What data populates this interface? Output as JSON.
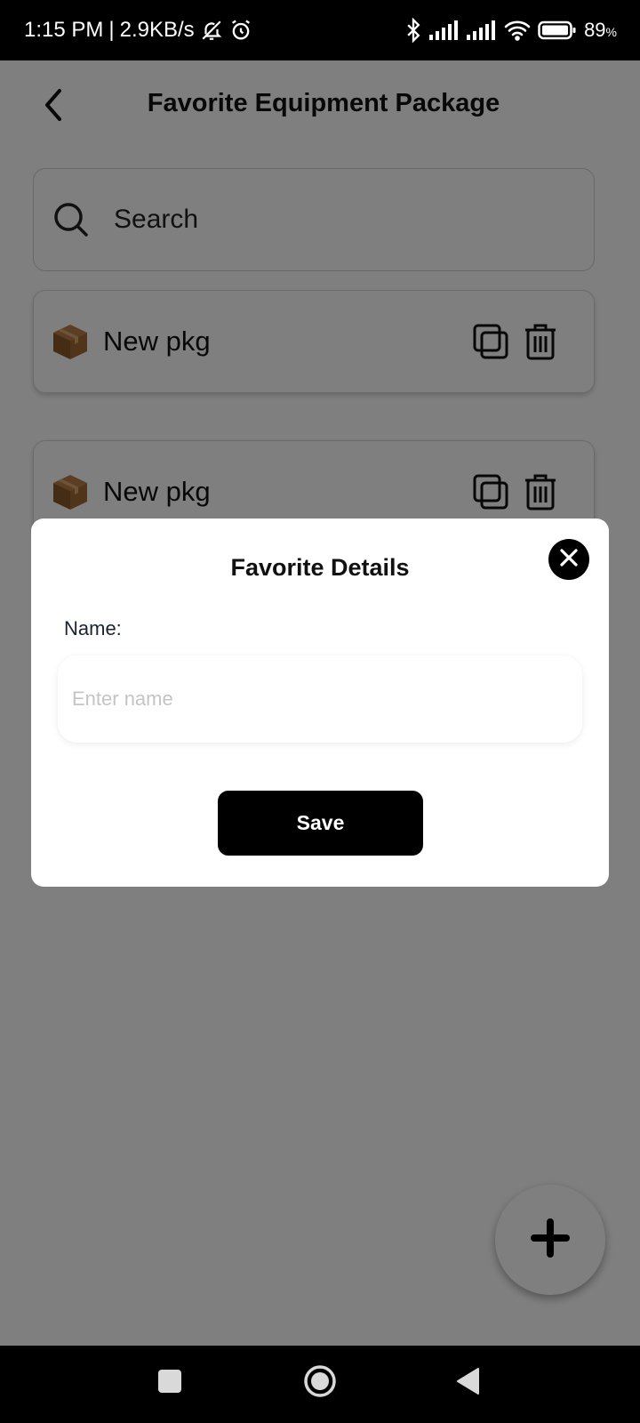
{
  "status_bar": {
    "time": "1:15 PM",
    "separator": "|",
    "network_speed": "2.9KB/s",
    "battery": "89",
    "battery_unit": "%",
    "icons": [
      "bell-off-icon",
      "alarm-icon",
      "bluetooth-icon",
      "signal-icon",
      "signal-icon",
      "wifi-icon",
      "battery-icon"
    ]
  },
  "header": {
    "title": "Favorite Equipment Package",
    "back_icon": "chevron-left-icon"
  },
  "search": {
    "placeholder": "Search",
    "value": ""
  },
  "packages": [
    {
      "name": "New pkg",
      "icon": "package-icon",
      "actions": [
        "copy-icon",
        "trash-icon"
      ]
    },
    {
      "name": "New pkg",
      "icon": "package-icon",
      "actions": [
        "copy-icon",
        "trash-icon"
      ]
    }
  ],
  "fab": {
    "icon": "plus-icon"
  },
  "modal": {
    "title": "Favorite Details",
    "close_icon": "close-icon",
    "name_label": "Name:",
    "name_placeholder": "Enter name",
    "name_value": "",
    "save_label": "Save"
  },
  "nav_bar": {
    "buttons": [
      "recents-square-icon",
      "home-circle-icon",
      "back-triangle-icon"
    ]
  },
  "colors": {
    "overlay": "#808080",
    "primary_button": "#000000",
    "package_brown": "#8b5a2b"
  }
}
